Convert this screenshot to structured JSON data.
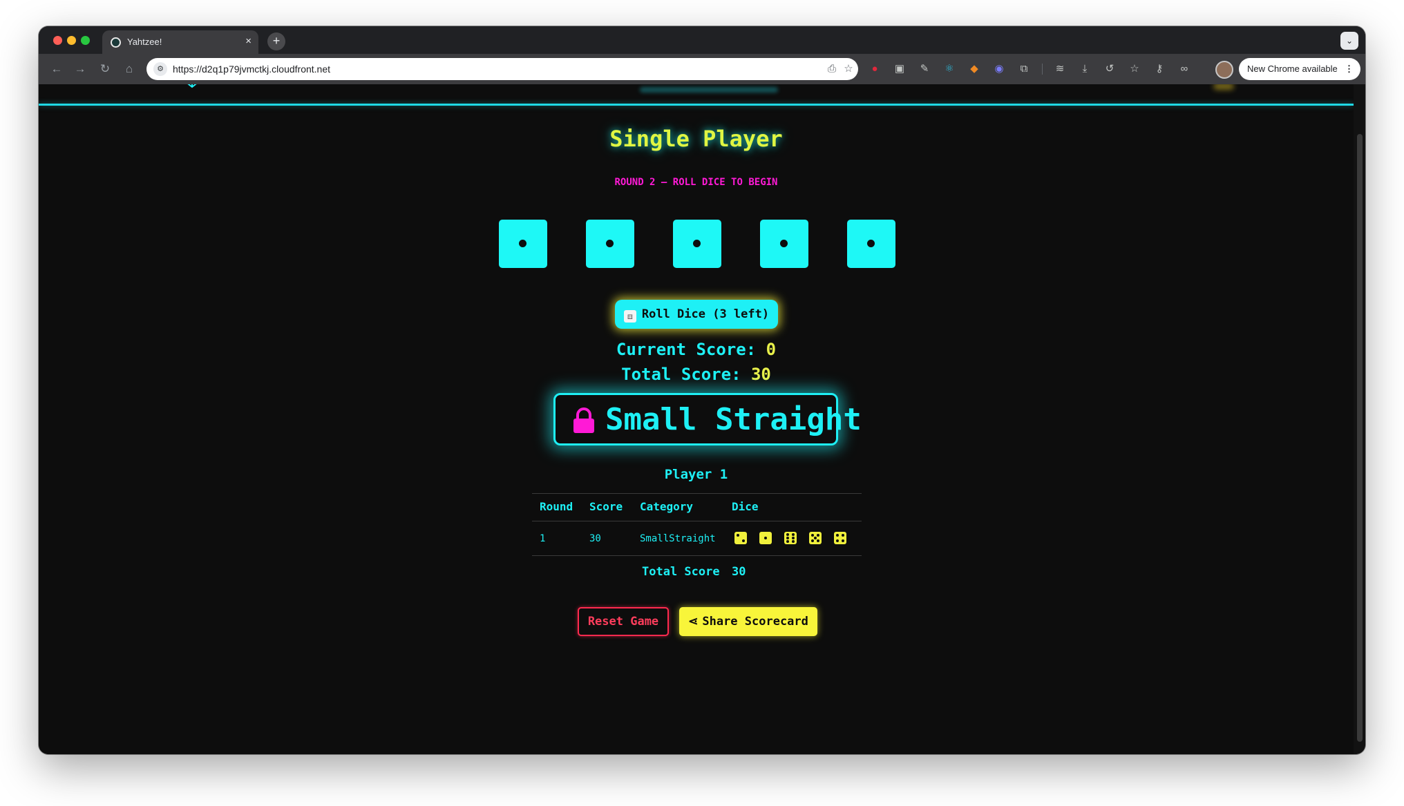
{
  "browser": {
    "tab_title": "Yahtzee!",
    "url": "https://d2q1p79jvmctkj.cloudfront.net",
    "update_label": "New Chrome available"
  },
  "game": {
    "mode_title": "Single Player",
    "round_status": "ROUND 2 — ROLL DICE TO BEGIN",
    "dice_values": [
      1,
      1,
      1,
      1,
      1
    ],
    "roll_button_label": "Roll Dice (3 left)",
    "current_score_label": "Current Score:",
    "current_score_value": "0",
    "total_score_label": "Total Score:",
    "total_score_value": "30",
    "combination_label": "Small Straight",
    "accent_colors": {
      "cyan": "#1ef0f5",
      "yellow": "#e8f04a",
      "magenta": "#ff1ad6",
      "red": "#ff2a4f",
      "background": "#0d0d0d"
    }
  },
  "scorecard": {
    "player_name": "Player 1",
    "headers": [
      "Round",
      "Score",
      "Category",
      "Dice"
    ],
    "rows": [
      {
        "round": "1",
        "score": "30",
        "category": "SmallStraight",
        "dice": [
          2,
          1,
          6,
          5,
          4
        ]
      }
    ],
    "total_label": "Total Score",
    "total_value": "30"
  },
  "actions": {
    "reset_label": "Reset Game",
    "share_label": "Share Scorecard"
  }
}
